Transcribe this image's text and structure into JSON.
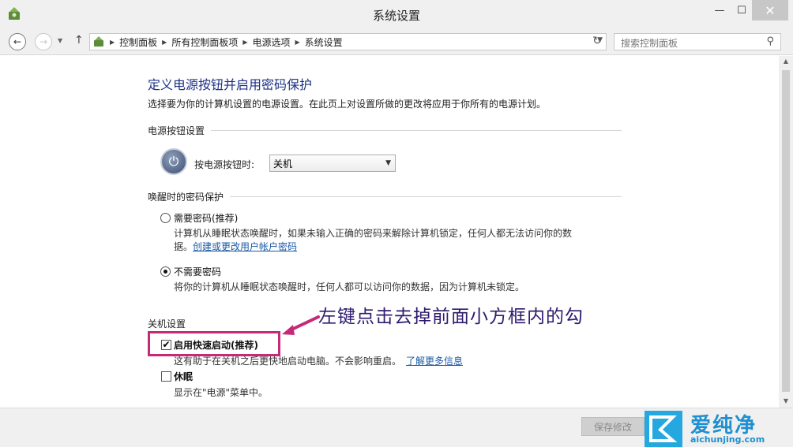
{
  "window": {
    "title": "系统设置",
    "minimize": "—",
    "maximize": "☐",
    "close": "✕"
  },
  "nav": {
    "back": "←",
    "forward": "→",
    "recent": "▼",
    "up": "↑"
  },
  "address": {
    "crumbs": [
      "控制面板",
      "所有控制面板项",
      "电源选项",
      "系统设置"
    ],
    "sep": "▶",
    "dropdown": "▼",
    "refresh": "↻"
  },
  "search": {
    "placeholder": "搜索控制面板",
    "icon": "⚲"
  },
  "main": {
    "heading": "定义电源按钮并启用密码保护",
    "description": "选择要为你的计算机设置的电源设置。在此页上对设置所做的更改将应用于你所有的电源计划。",
    "power_section": {
      "title": "电源按钮设置",
      "label": "按电源按钮时:",
      "selected": "关机",
      "arrow": "▼"
    },
    "wake_section": {
      "title": "唤醒时的密码保护",
      "options": [
        {
          "label": "需要密码(推荐)",
          "text": "计算机从睡眠状态唤醒时，如果未输入正确的密码来解除计算机锁定，任何人都无法访问你的数",
          "text2": "据。",
          "link": "创建或更改用户帐户密码",
          "checked": false
        },
        {
          "label": "不需要密码",
          "text": "将你的计算机从睡眠状态唤醒时，任何人都可以访问你的数据，因为计算机未锁定。",
          "checked": true
        }
      ]
    },
    "shutdown_section": {
      "title": "关机设置",
      "fast_startup": {
        "label": "启用快速启动(推荐)",
        "text": "这有助于在关机之后更快地启动电脑。不会影响重启。",
        "link": "了解更多信息",
        "checked": true
      },
      "hibernate": {
        "label": "休眠",
        "text": "显示在\"电源\"菜单中。",
        "checked": false
      }
    },
    "annotation": "左键点击去掉前面小方框内的勾"
  },
  "footer": {
    "save_label": "保存修改"
  },
  "watermark": {
    "name": "爱纯净",
    "url": "aichunjing.com"
  },
  "colors": {
    "heading": "#1e3287",
    "link": "#1a5aa6",
    "highlight": "#c42a78",
    "annotation": "#2e1a6f",
    "watermark": "#25a8e0"
  }
}
